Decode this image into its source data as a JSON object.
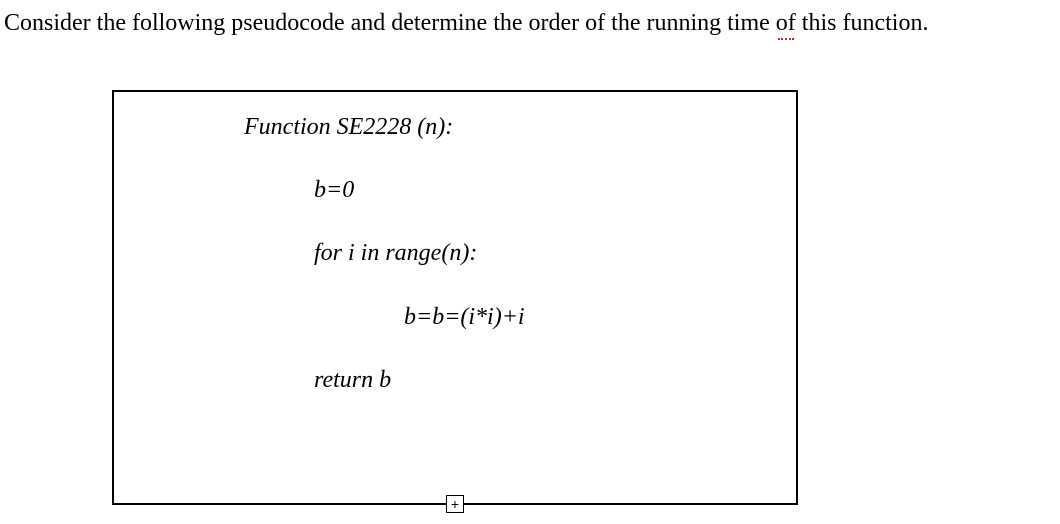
{
  "question": {
    "prefix": "Consider the following pseudocode and determine the order of the running time ",
    "underlined_word": "of",
    "suffix": " this function."
  },
  "code": {
    "header": "Function SE2228 (n):",
    "init": "b=0",
    "loop": "for i in range(n):",
    "body": "b=b=(i*i)+i",
    "ret": "return b"
  }
}
